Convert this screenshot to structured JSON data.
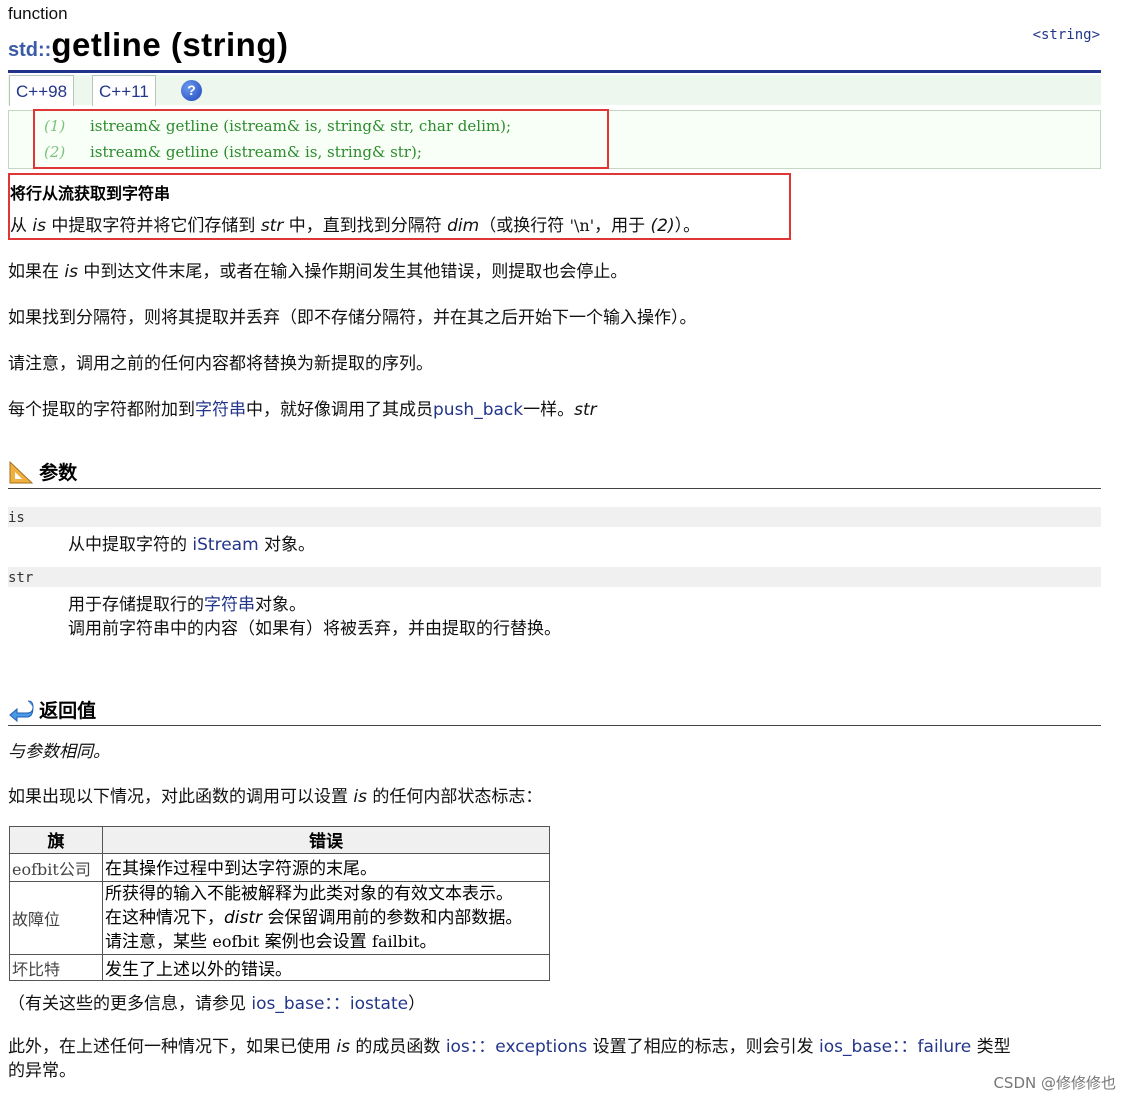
{
  "header": {
    "kind": "function",
    "namespace": "std::",
    "function_name": "getline (string)",
    "library": "<string>"
  },
  "versions": {
    "tabs": [
      "C++98",
      "C++11"
    ],
    "help": "?"
  },
  "prototypes": [
    {
      "num": "(1)",
      "code": "istream& getline (istream& is, string& str, char delim);"
    },
    {
      "num": "(2)",
      "code": "istream& getline (istream& is, string& str);"
    }
  ],
  "brief": {
    "title": "将行从流获取到字符串",
    "p1": "从",
    "p2": "is",
    "p3": "中提取字符并将它们存储到",
    "p4": "str",
    "p5": "中，直到找到分隔符",
    "p6": "dim",
    "p7": "（或换行符",
    "p8": "'\\n'",
    "p9": "，用于",
    "p10": "(2)",
    "p11": "）。"
  },
  "paragraphs": {
    "eof_1": "如果在",
    "eof_2": "is",
    "eof_3": "中到达文件末尾，或者在输入操作期间发生其他错误，则提取也会停止。",
    "delim": "如果找到分隔符，则将其提取并丢弃（即不存储分隔符，并在其之后开始下一个输入操作）。",
    "replace": "请注意，调用之前的任何内容都将替换为新提取的序列。",
    "append_1": "每个提取的字符都附加到",
    "append_link": "字符串",
    "append_2": "中，就好像调用了其成员",
    "append_method": "push_back",
    "append_3": "一样。",
    "append_4": "str"
  },
  "params": {
    "title": "参数",
    "is_name": "is",
    "is_desc_1": "从中提取字符的",
    "is_desc_link": "iStream",
    "is_desc_2": "对象。",
    "str_name": "str",
    "str_desc_1": "用于存储提取行的",
    "str_desc_link": "字符串",
    "str_desc_2": "对象。",
    "str_desc_3": "调用前字符串中的内容（如果有）将被丢弃，并由提取的行替换。"
  },
  "return": {
    "title": "返回值",
    "same": "与参数相同。",
    "flags_1": "如果出现以下情况，对此函数的调用可以设置",
    "flags_2": "is",
    "flags_3": "的任何内部状态标志：",
    "table": {
      "headers": [
        "旗",
        "错误"
      ],
      "rows": [
        {
          "flag": "eofbit公司",
          "desc": "在其操作过程中到达字符源的末尾。"
        },
        {
          "flag": "故障位",
          "l1": "所获得的输入不能被解释为此类对象的有效文本表示。",
          "l2a": "在这种情况下，",
          "l2b": "distr",
          "l2c": "会保留调用前的参数和内部数据。",
          "l3a": "请注意，某些",
          "l3b": "eofbit",
          "l3c": "案例也会设置",
          "l3d": "failbit",
          "l3e": "。"
        },
        {
          "flag": "坏比特",
          "desc": "发生了上述以外的错误。"
        }
      ]
    },
    "more_1": "（有关这些的更多信息，请参见",
    "more_link": "ios_base：：iostate",
    "more_2": "）",
    "exc_1": "此外，在上述任何一种情况下，如果已使用",
    "exc_2": "is",
    "exc_3": "的成员函数",
    "exc_link1": "ios：：exceptions",
    "exc_4": "设置了相应的标志，则会引发",
    "exc_link2": "ios_base：：failure",
    "exc_5": "类型",
    "exc_6": "的异常。"
  },
  "watermark": "CSDN @修修修也"
}
